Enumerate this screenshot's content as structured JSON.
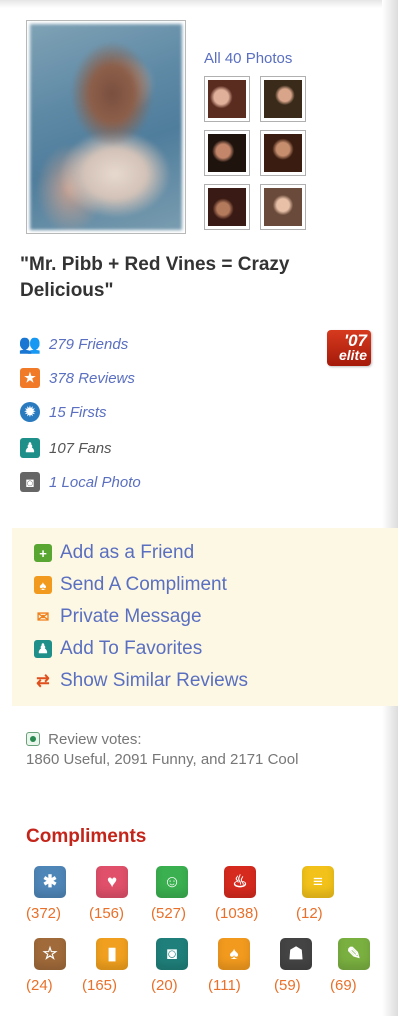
{
  "profile": {
    "all_photos_label": "All 40 Photos",
    "quote": "\"Mr. Pibb + Red Vines = Crazy Delicious\""
  },
  "stats": [
    {
      "icon": "friends-icon",
      "label": "279 Friends",
      "color": "#3aa0a8"
    },
    {
      "icon": "reviews-star-icon",
      "label": "378 Reviews",
      "color": "#f07a28"
    },
    {
      "icon": "firsts-badge-icon",
      "label": "15 Firsts",
      "color": "#2a7abf"
    },
    {
      "icon": "fans-icon",
      "label": "107 Fans",
      "color": "#1f8f8a"
    },
    {
      "icon": "camera-icon",
      "label": "1 Local Photo",
      "color": "#777777"
    }
  ],
  "elite": {
    "year": "'07",
    "label": "elite"
  },
  "actions": [
    {
      "icon": "add-friend-icon",
      "label": "Add as a Friend",
      "color": "#5aa632",
      "glyph": "+"
    },
    {
      "icon": "compliment-icon",
      "label": "Send A Compliment",
      "color": "#f29a1e",
      "glyph": "♠"
    },
    {
      "icon": "private-message-icon",
      "label": "Private Message",
      "color": "#f0801e",
      "glyph": "✉"
    },
    {
      "icon": "favorites-icon",
      "label": "Add To Favorites",
      "color": "#1f8f8a",
      "glyph": "♟"
    },
    {
      "icon": "similar-reviews-icon",
      "label": "Show Similar Reviews",
      "color": "#e0501e",
      "glyph": "⇄"
    }
  ],
  "votes": {
    "label": "Review votes:",
    "text": "1860 Useful, 2091 Funny, and 2171 Cool"
  },
  "compliments": {
    "title": "Compliments",
    "row1": [
      {
        "icon": "snowflake-icon",
        "count": "(372)",
        "color": "#4f86b8",
        "glyph": "✱"
      },
      {
        "icon": "heart-icon",
        "count": "(156)",
        "color": "#e0506a",
        "glyph": "♥"
      },
      {
        "icon": "smiley-icon",
        "count": "(527)",
        "color": "#3ab050",
        "glyph": "☺"
      },
      {
        "icon": "flame-icon",
        "count": "(1038)",
        "color": "#d62a1e",
        "glyph": "♨"
      },
      {
        "icon": "list-icon",
        "count": "(12)",
        "color": "#f2c21a",
        "glyph": "≡"
      }
    ],
    "row2": [
      {
        "icon": "star-frame-icon",
        "count": "(24)",
        "color": "#a06a3a",
        "glyph": "☆"
      },
      {
        "icon": "note-icon",
        "count": "(165)",
        "color": "#f0a01e",
        "glyph": "▮"
      },
      {
        "icon": "camera-compliment-icon",
        "count": "(20)",
        "color": "#1f7f7a",
        "glyph": "◙"
      },
      {
        "icon": "ribbon-icon",
        "count": "(111)",
        "color": "#f29a1e",
        "glyph": "♠"
      },
      {
        "icon": "profile-icon",
        "count": "(59)",
        "color": "#444444",
        "glyph": "☗"
      },
      {
        "icon": "pencil-icon",
        "count": "(69)",
        "color": "#7ab040",
        "glyph": "✎"
      }
    ]
  }
}
